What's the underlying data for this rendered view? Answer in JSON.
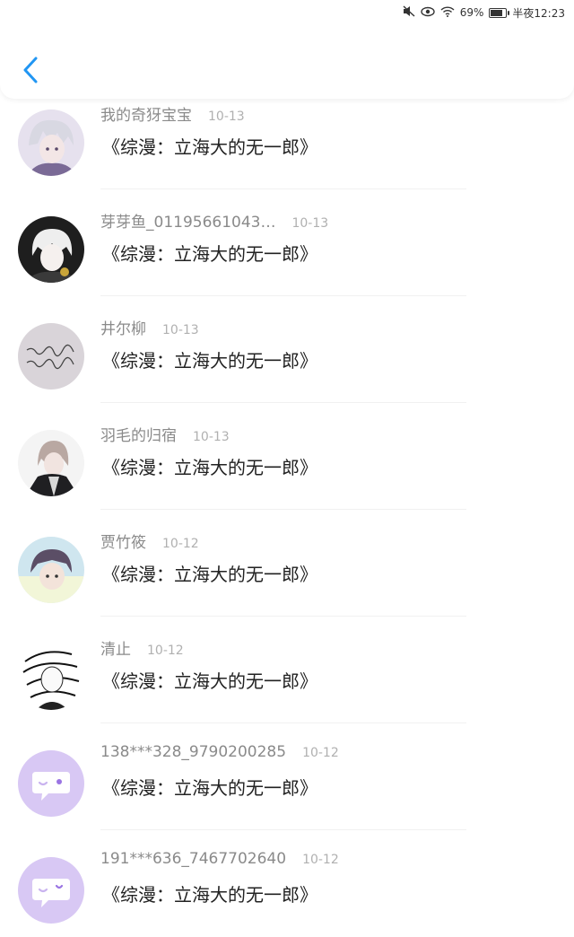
{
  "status_bar": {
    "battery_percent": "69%",
    "time": "半夜12:23",
    "icons": [
      "mute-icon",
      "eye-icon",
      "wifi-icon",
      "battery-icon"
    ]
  },
  "header": {
    "back_icon": "chevron-left-icon",
    "accent_color": "#2196F3"
  },
  "items": [
    {
      "username": "我的奇犽宝宝",
      "date": "10-13",
      "title": "《综漫：立海大的无一郎》",
      "avatar": "anime-boy-silver-hair"
    },
    {
      "username": "芽芽鱼_01195661043…",
      "date": "10-13",
      "title": "《综漫：立海大的无一郎》",
      "avatar": "anime-boy-white-hair-dark"
    },
    {
      "username": "井尔柳",
      "date": "10-13",
      "title": "《综漫：立海大的无一郎》",
      "avatar": "handwritten-text"
    },
    {
      "username": "羽毛的归宿",
      "date": "10-13",
      "title": "《综漫：立海大的无一郎》",
      "avatar": "anime-boy-black-robe"
    },
    {
      "username": "贾竹筱",
      "date": "10-12",
      "title": "《综漫：立海大的无一郎》",
      "avatar": "photo-person"
    },
    {
      "username": "清止",
      "date": "10-12",
      "title": "《综漫：立海大的无一郎》",
      "avatar": "manga-sketch"
    },
    {
      "username": "138***328_9790200285",
      "date": "10-12",
      "title": "《综漫：立海大的无一郎》",
      "avatar": "default-chat-bubble"
    },
    {
      "username": "191***636_7467702640",
      "date": "10-12",
      "title": "《综漫：立海大的无一郎》",
      "avatar": "default-chat-bubble"
    }
  ]
}
